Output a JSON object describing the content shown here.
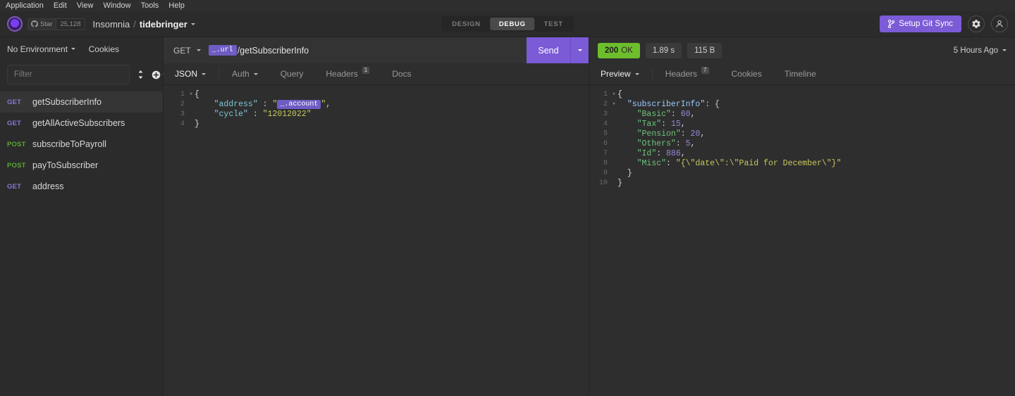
{
  "menubar": {
    "items": [
      "Application",
      "Edit",
      "View",
      "Window",
      "Tools",
      "Help"
    ]
  },
  "header": {
    "star_label": "Star",
    "star_count": "25,128",
    "app_name": "Insomnia",
    "separator": "/",
    "workspace": "tidebringer",
    "modes": [
      {
        "label": "DESIGN",
        "active": false
      },
      {
        "label": "DEBUG",
        "active": true
      },
      {
        "label": "TEST",
        "active": false
      }
    ],
    "git_sync_label": "Setup Git Sync",
    "settings_icon": "gear-icon",
    "account_icon": "account-icon",
    "accent_color": "#7b5bd6"
  },
  "sidebar": {
    "environment": "No Environment",
    "cookies_label": "Cookies",
    "filter_placeholder": "Filter",
    "sort_icon": "sort-icon",
    "add_icon": "plus-circle-icon",
    "requests": [
      {
        "method": "GET",
        "name": "getSubscriberInfo",
        "selected": true
      },
      {
        "method": "GET",
        "name": "getAllActiveSubscribers",
        "selected": false
      },
      {
        "method": "POST",
        "name": "subscribeToPayroll",
        "selected": false
      },
      {
        "method": "POST",
        "name": "payToSubscriber",
        "selected": false
      },
      {
        "method": "GET",
        "name": "address",
        "selected": false
      }
    ],
    "method_colors": {
      "get": "#8779d4",
      "post": "#5aa832"
    }
  },
  "request": {
    "method": "GET",
    "url_template_tag": "_.url",
    "url_path": "/getSubscriberInfo",
    "send_label": "Send",
    "tabs": [
      {
        "label": "JSON",
        "active": true,
        "dropdown": true,
        "badge": null
      },
      {
        "label": "Auth",
        "active": false,
        "dropdown": true,
        "badge": null
      },
      {
        "label": "Query",
        "active": false,
        "dropdown": false,
        "badge": null
      },
      {
        "label": "Headers",
        "active": false,
        "dropdown": false,
        "badge": "1"
      },
      {
        "label": "Docs",
        "active": false,
        "dropdown": false,
        "badge": null
      }
    ],
    "body_lines": [
      {
        "n": "1",
        "fold": "▾",
        "tokens": [
          {
            "t": "brace",
            "v": "{"
          }
        ]
      },
      {
        "n": "2",
        "fold": "",
        "tokens": [
          {
            "t": "sp",
            "v": "    "
          },
          {
            "t": "key",
            "v": "\"address\""
          },
          {
            "t": "pun",
            "v": " : "
          },
          {
            "t": "str",
            "v": "\""
          },
          {
            "t": "tag",
            "v": "_.account"
          },
          {
            "t": "str",
            "v": "\""
          },
          {
            "t": "pun",
            "v": ","
          }
        ]
      },
      {
        "n": "3",
        "fold": "",
        "tokens": [
          {
            "t": "sp",
            "v": "    "
          },
          {
            "t": "key",
            "v": "\"cycle\""
          },
          {
            "t": "pun",
            "v": " : "
          },
          {
            "t": "str",
            "v": "\"12012022\""
          }
        ]
      },
      {
        "n": "4",
        "fold": "",
        "tokens": [
          {
            "t": "brace",
            "v": "}"
          }
        ]
      }
    ]
  },
  "response": {
    "status_code": "200",
    "status_text": "OK",
    "time": "1.89 s",
    "size": "115 B",
    "time_ago": "5 Hours Ago",
    "tabs": [
      {
        "label": "Preview",
        "active": true,
        "dropdown": true,
        "badge": null
      },
      {
        "label": "Headers",
        "active": false,
        "dropdown": false,
        "badge": "7"
      },
      {
        "label": "Cookies",
        "active": false,
        "dropdown": false,
        "badge": null
      },
      {
        "label": "Timeline",
        "active": false,
        "dropdown": false,
        "badge": null
      }
    ],
    "body_lines": [
      {
        "n": "1",
        "fold": "▾",
        "tokens": [
          {
            "t": "brace",
            "v": "{"
          }
        ]
      },
      {
        "n": "2",
        "fold": "▾",
        "tokens": [
          {
            "t": "sp",
            "v": "  "
          },
          {
            "t": "rootkey",
            "v": "\"subscriberInfo\""
          },
          {
            "t": "pun",
            "v": ": {"
          }
        ]
      },
      {
        "n": "3",
        "fold": "",
        "tokens": [
          {
            "t": "sp",
            "v": "    "
          },
          {
            "t": "key",
            "v": "\"Basic\""
          },
          {
            "t": "pun",
            "v": ": "
          },
          {
            "t": "num",
            "v": "60"
          },
          {
            "t": "pun",
            "v": ","
          }
        ]
      },
      {
        "n": "4",
        "fold": "",
        "tokens": [
          {
            "t": "sp",
            "v": "    "
          },
          {
            "t": "key",
            "v": "\"Tax\""
          },
          {
            "t": "pun",
            "v": ": "
          },
          {
            "t": "num",
            "v": "15"
          },
          {
            "t": "pun",
            "v": ","
          }
        ]
      },
      {
        "n": "5",
        "fold": "",
        "tokens": [
          {
            "t": "sp",
            "v": "    "
          },
          {
            "t": "key",
            "v": "\"Pension\""
          },
          {
            "t": "pun",
            "v": ": "
          },
          {
            "t": "num",
            "v": "20"
          },
          {
            "t": "pun",
            "v": ","
          }
        ]
      },
      {
        "n": "6",
        "fold": "",
        "tokens": [
          {
            "t": "sp",
            "v": "    "
          },
          {
            "t": "key",
            "v": "\"Others\""
          },
          {
            "t": "pun",
            "v": ": "
          },
          {
            "t": "num",
            "v": "5"
          },
          {
            "t": "pun",
            "v": ","
          }
        ]
      },
      {
        "n": "7",
        "fold": "",
        "tokens": [
          {
            "t": "sp",
            "v": "    "
          },
          {
            "t": "key",
            "v": "\"Id\""
          },
          {
            "t": "pun",
            "v": ": "
          },
          {
            "t": "num",
            "v": "886"
          },
          {
            "t": "pun",
            "v": ","
          }
        ]
      },
      {
        "n": "8",
        "fold": "",
        "tokens": [
          {
            "t": "sp",
            "v": "    "
          },
          {
            "t": "key",
            "v": "\"Misc\""
          },
          {
            "t": "pun",
            "v": ": "
          },
          {
            "t": "str",
            "v": "\"{\\\"date\\\":\\\"Paid for December\\\"}\""
          }
        ]
      },
      {
        "n": "9",
        "fold": "",
        "tokens": [
          {
            "t": "sp",
            "v": "  "
          },
          {
            "t": "brace",
            "v": "}"
          }
        ]
      },
      {
        "n": "10",
        "fold": "",
        "tokens": [
          {
            "t": "brace",
            "v": "}"
          }
        ]
      }
    ]
  }
}
